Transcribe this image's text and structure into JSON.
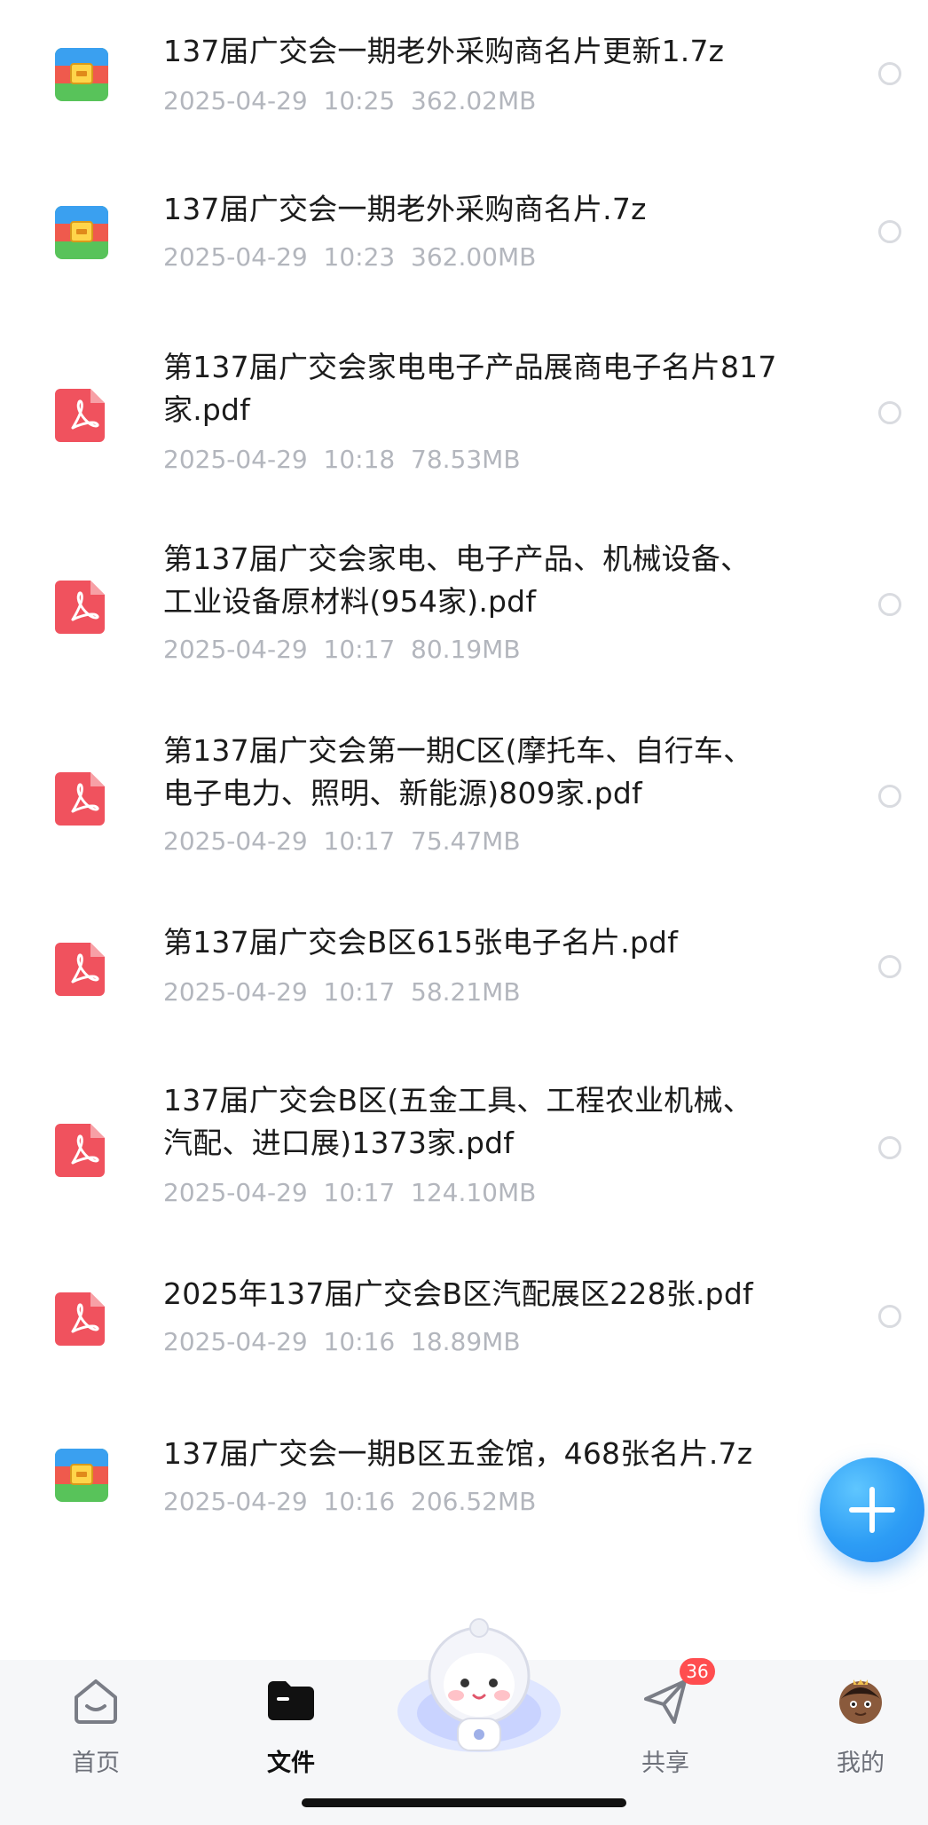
{
  "files": [
    {
      "name": "137届广交会一期老外采购商名片更新1.7z",
      "meta": "2025-04-29  10:25  362.02MB",
      "type": "archive",
      "icon": "archive-icon"
    },
    {
      "name": "137届广交会一期老外采购商名片.7z",
      "meta": "2025-04-29  10:23  362.00MB",
      "type": "archive",
      "icon": "archive-icon"
    },
    {
      "name": "第137届广交会家电电子产品展商电子名片817\n家.pdf",
      "meta": "2025-04-29  10:18  78.53MB",
      "type": "pdf",
      "icon": "pdf-icon"
    },
    {
      "name": "第137届广交会家电、电子产品、机械设备、\n工业设备原材料(954家).pdf",
      "meta": "2025-04-29  10:17  80.19MB",
      "type": "pdf",
      "icon": "pdf-icon"
    },
    {
      "name": "第137届广交会第一期C区(摩托车、自行车、\n电子电力、照明、新能源)809家.pdf",
      "meta": "2025-04-29  10:17  75.47MB",
      "type": "pdf",
      "icon": "pdf-icon"
    },
    {
      "name": "第137届广交会B区615张电子名片.pdf",
      "meta": "2025-04-29  10:17  58.21MB",
      "type": "pdf",
      "icon": "pdf-icon"
    },
    {
      "name": "137届广交会B区(五金工具、工程农业机械、\n汽配、进口展)1373家.pdf",
      "meta": "2025-04-29  10:17  124.10MB",
      "type": "pdf",
      "icon": "pdf-icon"
    },
    {
      "name": "2025年137届广交会B区汽配展区228张.pdf",
      "meta": "2025-04-29  10:16  18.89MB",
      "type": "pdf",
      "icon": "pdf-icon"
    },
    {
      "name": "137届广交会一期B区五金馆，468张名片.7z",
      "meta": "2025-04-29  10:16  206.52MB",
      "type": "archive",
      "icon": "archive-icon"
    }
  ],
  "fab": {
    "icon": "plus-icon"
  },
  "tabs": [
    {
      "label": "首页",
      "icon": "home-icon",
      "active": false
    },
    {
      "label": "文件",
      "icon": "folder-icon",
      "active": true
    },
    {
      "label": "共享",
      "icon": "send-icon",
      "active": false,
      "badge": "36"
    },
    {
      "label": "我的",
      "icon": "avatar-icon",
      "active": false
    }
  ],
  "colors": {
    "pdf": "#f0525e",
    "accent": "#2d9df5",
    "badge": "#ff4d4f",
    "meta_text": "#b3b6bd"
  }
}
